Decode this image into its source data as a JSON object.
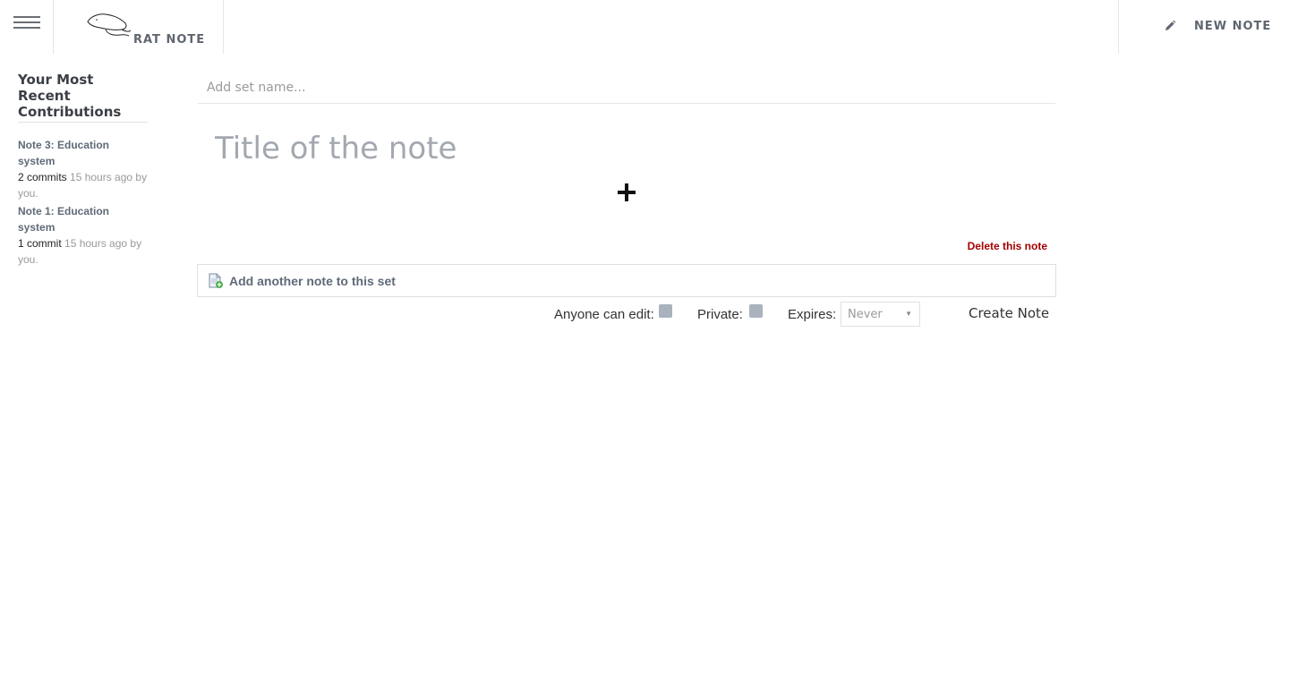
{
  "header": {
    "brand_name": "RAT NOTE",
    "new_note_label": "NEW NOTE"
  },
  "sidebar": {
    "heading": "Your Most Recent Contributions",
    "contributions": [
      {
        "title": "Note 3: Education system",
        "commits": "2 commits",
        "meta": " 15 hours ago by you."
      },
      {
        "title": "Note 1: Education system",
        "commits": "1 commit",
        "meta": " 15 hours ago by you."
      }
    ]
  },
  "editor": {
    "set_name_placeholder": "Add set name...",
    "title_placeholder": "Title of the note",
    "delete_label": "Delete this note",
    "add_another_label": "Add another note to this set"
  },
  "options": {
    "anyone_can_edit_label": "Anyone can edit:",
    "private_label": "Private:",
    "expires_label": "Expires:",
    "expires_value": "Never",
    "create_label": "Create Note"
  }
}
